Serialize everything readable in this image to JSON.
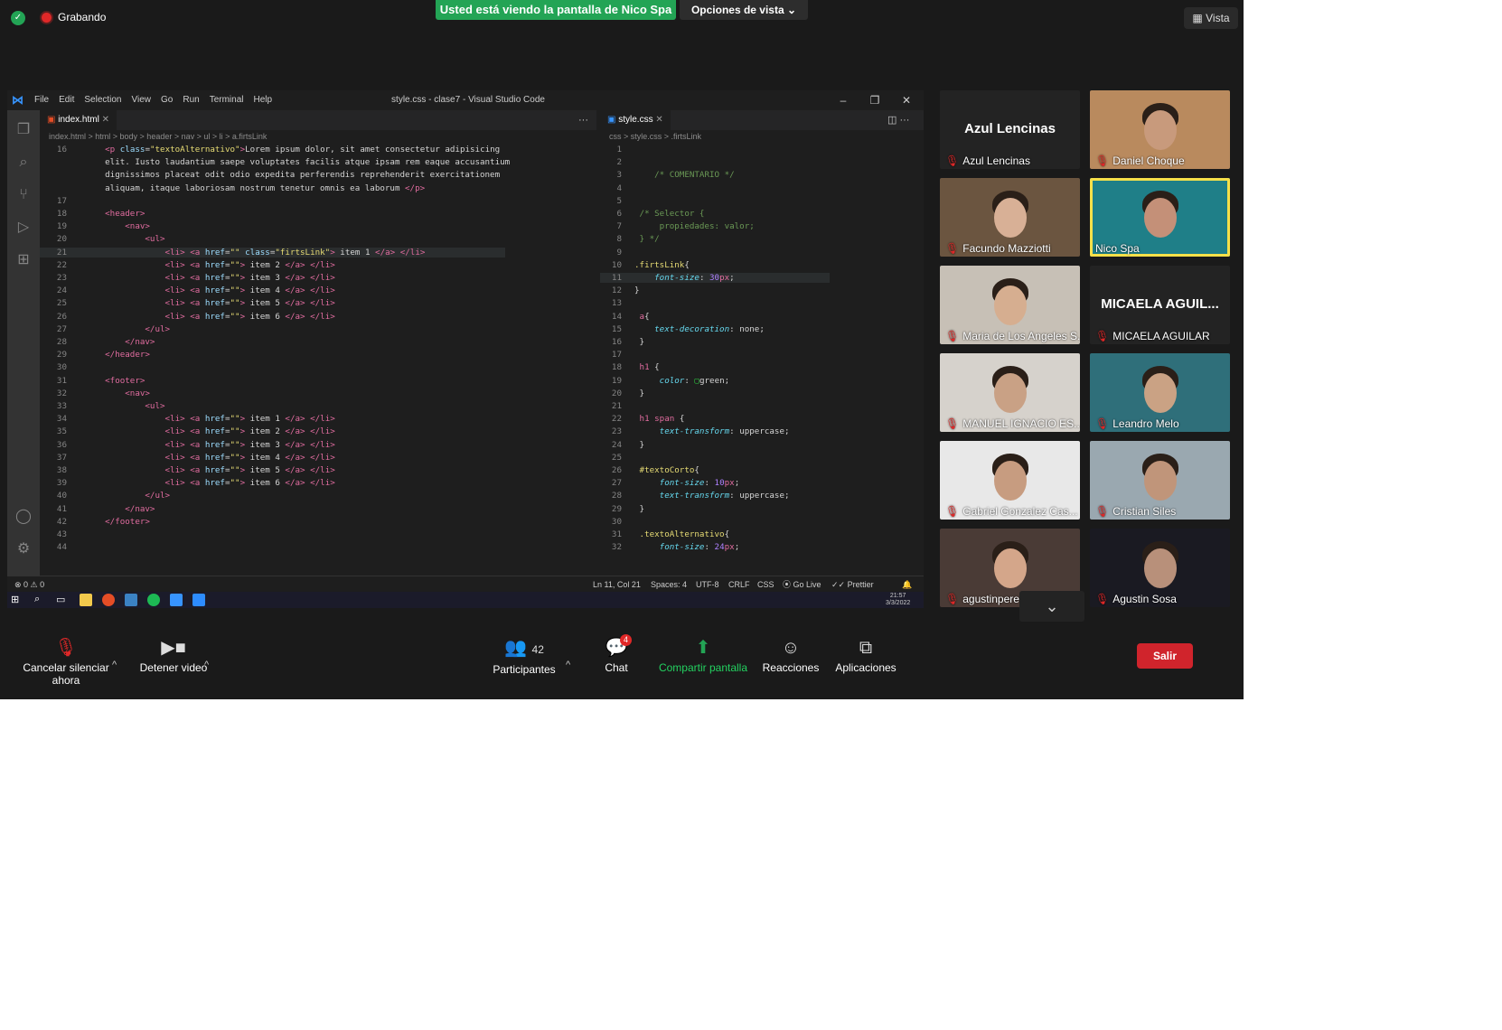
{
  "zoom": {
    "recording_label": "Grabando",
    "share_banner": "Usted está viendo la pantalla de Nico Spa",
    "view_options": "Opciones de vista",
    "view_mode": "Vista",
    "toolbar": {
      "mute": "Cancelar silenciar ahora",
      "video": "Detener video",
      "participants": "Participantes",
      "participants_count": "42",
      "chat": "Chat",
      "chat_badge": "4",
      "share": "Compartir pantalla",
      "reactions": "Reacciones",
      "apps": "Aplicaciones",
      "leave": "Salir"
    },
    "participants": [
      {
        "name": "Azul Lencinas",
        "video": false,
        "big": "Azul Lencinas"
      },
      {
        "name": "Daniel Choque",
        "video": true
      },
      {
        "name": "Facundo Mazziotti",
        "video": true
      },
      {
        "name": "Nico Spa",
        "video": true
      },
      {
        "name": "Maria de Los Angeles S...",
        "video": true
      },
      {
        "name": "MICAELA AGUILAR",
        "video": false,
        "big": "MICAELA AGUIL..."
      },
      {
        "name": "MANUEL IGNACIO ES...",
        "video": true
      },
      {
        "name": "Leandro Melo",
        "video": true
      },
      {
        "name": "Gabriel Gonzalez Cas...",
        "video": true
      },
      {
        "name": "Cristian Siles",
        "video": true
      },
      {
        "name": "agustinpere",
        "video": true
      },
      {
        "name": "Agustin Sosa",
        "video": true
      }
    ]
  },
  "vscode": {
    "menus": [
      "File",
      "Edit",
      "Selection",
      "View",
      "Go",
      "Run",
      "Terminal",
      "Help"
    ],
    "window_title": "style.css - clase7 - Visual Studio Code",
    "tab1": "index.html",
    "tab2": "style.css",
    "crumbs1": "index.html > html > body > header > nav > ul > li > a.firtsLink",
    "crumbs2": "css > style.css > .firtsLink",
    "status": {
      "problems": "⊗ 0 ⚠ 0",
      "position": "Ln 11, Col 21",
      "spaces": "Spaces: 4",
      "encoding": "UTF-8",
      "eol": "CRLF",
      "lang": "CSS",
      "golive": "Go Live",
      "prettier": "Prettier"
    },
    "clock_time": "21:57",
    "clock_date": "3/3/2022"
  }
}
